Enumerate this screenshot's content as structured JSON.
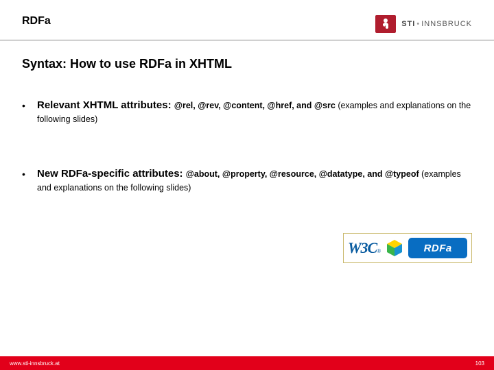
{
  "header": {
    "title": "RDFa",
    "brand_main": "STI",
    "brand_sep": "•",
    "brand_sub": "INNSBRUCK"
  },
  "title": "Syntax: How to use RDFa in XHTML",
  "bullets": [
    {
      "lead": "Relevant XHTML attributes: ",
      "attrs": "@rel, @rev, @content, @href, and @src",
      "tail": " (examples and explanations on the following slides)"
    },
    {
      "lead": "New RDFa-specific attributes: ",
      "attrs": "@about, @property, @resource, @datatype, and @typeof",
      "tail": " (examples and explanations on the following slides)"
    }
  ],
  "badge": {
    "w3c": "W3C",
    "reg": "®",
    "rdfa": "RDFa"
  },
  "footer": {
    "url": "www.sti-innsbruck.at",
    "page": "103"
  }
}
